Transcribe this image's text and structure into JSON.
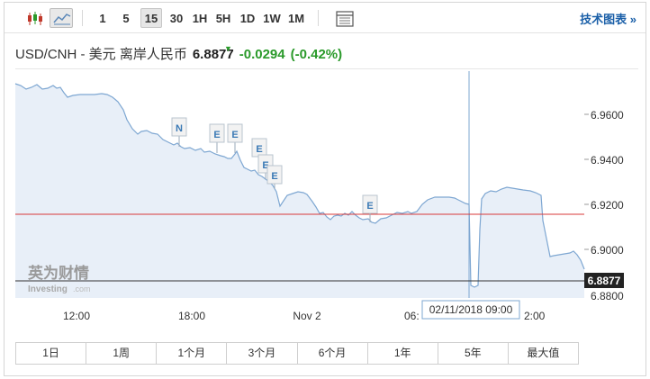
{
  "toolbar": {
    "intervals": [
      "1",
      "5",
      "15",
      "30",
      "1H",
      "5H",
      "1D",
      "1W",
      "1M"
    ],
    "active_interval": "15",
    "tech_chart_label": "技术图表 »"
  },
  "quote": {
    "pair": "USD/CNH - 美元 离岸人民币",
    "price": "6.8877",
    "change": "-0.0294",
    "change_pct": "(-0.42%)"
  },
  "chart": {
    "y_ticks": [
      "6.9600",
      "6.9400",
      "6.9200",
      "6.9000",
      "6.8800"
    ],
    "x_ticks": [
      "12:00",
      "18:00",
      "Nov 2",
      "06:",
      "2:00"
    ],
    "current_price_label": "6.8877",
    "hover_date_label": "02/11/2018 09:00",
    "event_flags": [
      "N",
      "E",
      "E",
      "E",
      "E",
      "E",
      "E"
    ],
    "watermark_cn": "英为财情",
    "watermark_en": "Investing",
    "watermark_suffix": ".com"
  },
  "chart_data": {
    "type": "area",
    "series": [],
    "y_range": [
      6.88,
      6.97
    ],
    "reference_level": 6.917,
    "last_value": 6.8877
  },
  "ranges": [
    "1日",
    "1周",
    "1个月",
    "3个月",
    "6个月",
    "1年",
    "5年",
    "最大值"
  ],
  "colors": {
    "line": "#7ea7d2",
    "area": "#e8eff8",
    "reference_line": "#d93a3a",
    "positive": "#2a9a2a",
    "link": "#1a5fa8"
  }
}
